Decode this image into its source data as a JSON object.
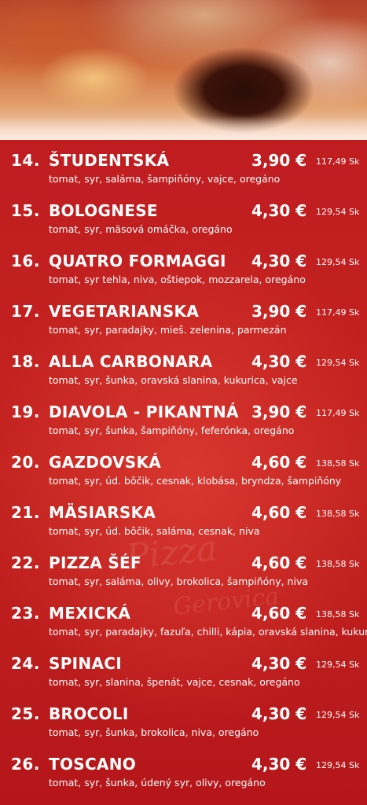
{
  "menu": {
    "items": [
      {
        "number": "14.",
        "name": "ŠTUDENTSKÁ",
        "price": "3,90 €",
        "price_sk": "117,49 Sk",
        "ingredients": "tomat, syr, saláma, šampiňóny, vajce, oregáno"
      },
      {
        "number": "15.",
        "name": "BOLOGNESE",
        "price": "4,30 €",
        "price_sk": "129,54 Sk",
        "ingredients": "tomat, syr, mäsová omáčka, oregáno"
      },
      {
        "number": "16.",
        "name": "QUATRO FORMAGGI",
        "price": "4,30 €",
        "price_sk": "129,54 Sk",
        "ingredients": "tomat, syr tehla, niva, oštiepok, mozzarela, oregáno"
      },
      {
        "number": "17.",
        "name": "VEGETARIANSKA",
        "price": "3,90 €",
        "price_sk": "117,49 Sk",
        "ingredients": "tomat, syr, paradajky, mieš. zelenina, parmezán"
      },
      {
        "number": "18.",
        "name": "ALLA CARBONARA",
        "price": "4,30 €",
        "price_sk": "129,54 Sk",
        "ingredients": "tomat, syr, šunka, oravská slanina, kukurica, vajce"
      },
      {
        "number": "19.",
        "name": "DIAVOLA - PIKANTNÁ",
        "price": "3,90 €",
        "price_sk": "117,49 Sk",
        "ingredients": "tomat, syr, šunka, šampiňóny, feferónka, oregáno"
      },
      {
        "number": "20.",
        "name": "GAZDOVSKÁ",
        "price": "4,60 €",
        "price_sk": "138,58 Sk",
        "ingredients": "tomat, syr, úd. bôčik, cesnak, klobása, bryndza, šampiňóny"
      },
      {
        "number": "21.",
        "name": "MÄSIARSKA",
        "price": "4,60 €",
        "price_sk": "138,58 Sk",
        "ingredients": "tomat, syr, úd. bôčik, saláma, cesnak, niva"
      },
      {
        "number": "22.",
        "name": "PIZZA ŠÉF",
        "price": "4,60 €",
        "price_sk": "138,58 Sk",
        "ingredients": "tomat, syr, saláma, olivy, brokolica, šampiňóny, niva"
      },
      {
        "number": "23.",
        "name": "MEXICKÁ",
        "price": "4,60 €",
        "price_sk": "138,58 Sk",
        "ingredients": "tomat, syr, paradajky, fazuľa, chilli, kápia, oravská slanina, kukurica"
      },
      {
        "number": "24.",
        "name": "SPINACI",
        "price": "4,30 €",
        "price_sk": "129,54 Sk",
        "ingredients": "tomat, syr, slanina, špenát, vajce, cesnak, oregáno"
      },
      {
        "number": "25.",
        "name": "BROCOLI",
        "price": "4,30 €",
        "price_sk": "129,54 Sk",
        "ingredients": "tomat, syr, šunka, brokolica, niva, oregáno"
      },
      {
        "number": "26.",
        "name": "TOSCANO",
        "price": "4,30 €",
        "price_sk": "129,54 Sk",
        "ingredients": "tomat, syr, šunka, údený syr, olivy, oregáno"
      }
    ]
  },
  "watermark": {
    "line1": "Pizza",
    "line2": "Gerovica"
  },
  "colors": {
    "background": "#c01d20",
    "text": "#ffffff"
  }
}
